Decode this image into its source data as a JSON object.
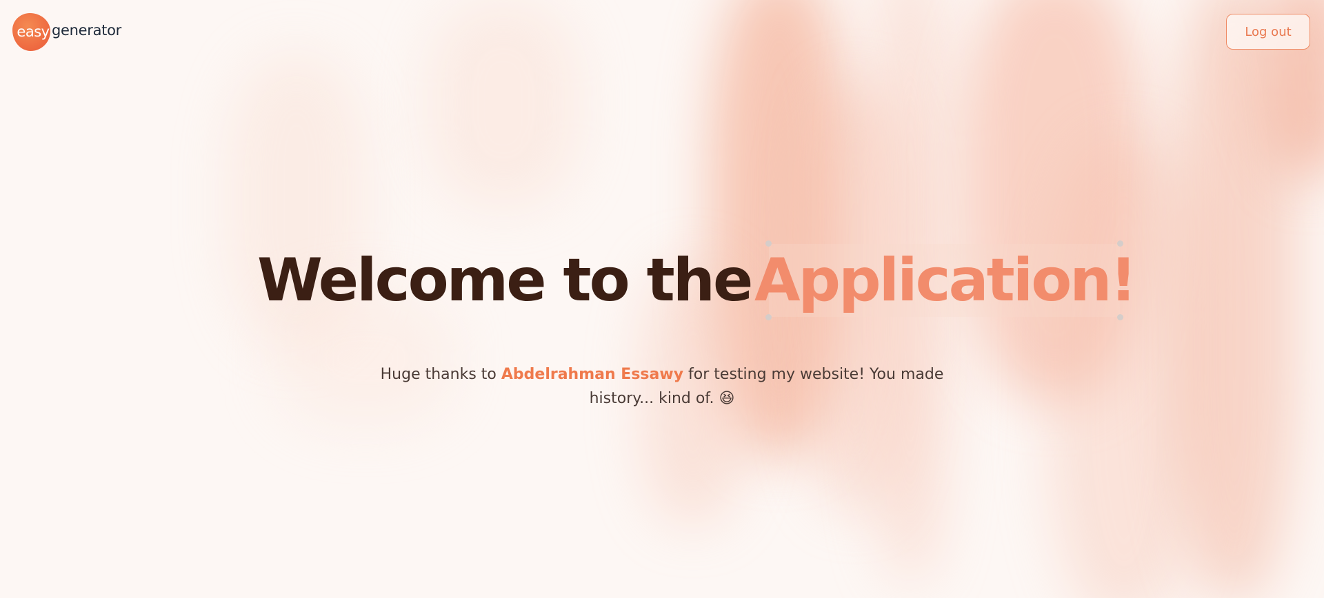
{
  "header": {
    "logo_badge_text": "easy",
    "logo_word": "generator",
    "logout_label": "Log out"
  },
  "hero": {
    "title_main": "Welcome to the",
    "title_accent": "Application!",
    "subtitle_prefix": "Huge thanks to ",
    "subtitle_name": "Abdelrahman Essawy",
    "subtitle_suffix": " for testing my website! You made history... kind of. 😆"
  },
  "colors": {
    "background": "#fdf7f4",
    "accent": "#f28c6c",
    "title_dark": "#3b1f14",
    "name_highlight": "#ef7a4c",
    "logo_orange": "#ef6d42"
  }
}
